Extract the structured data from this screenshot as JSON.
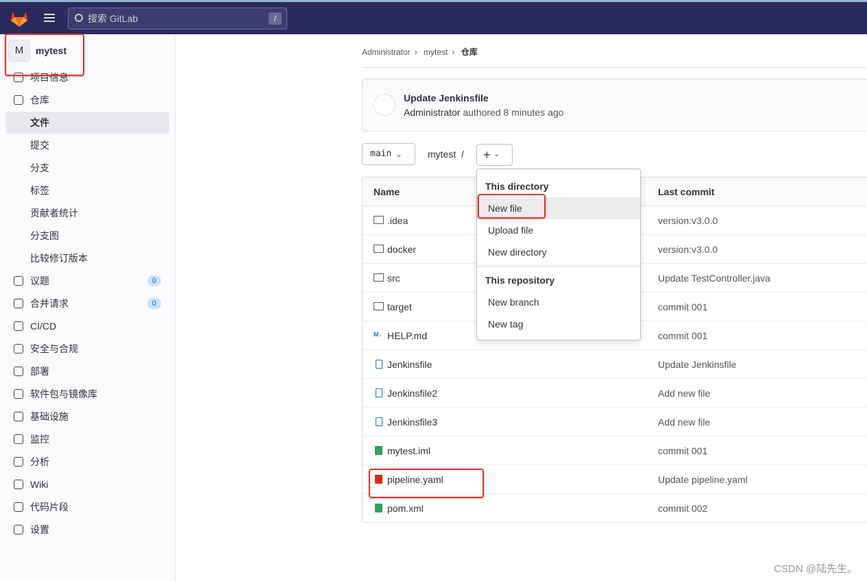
{
  "topbar": {
    "search_placeholder": "搜索 GitLab",
    "shortcut": "/"
  },
  "project": {
    "initial": "M",
    "name": "mytest"
  },
  "sidebar": {
    "items": [
      {
        "label": "项目信息",
        "icon": "project-info-icon"
      },
      {
        "label": "仓库",
        "icon": "repository-icon"
      },
      {
        "label": "文件",
        "active": true
      },
      {
        "label": "提交"
      },
      {
        "label": "分支"
      },
      {
        "label": "标签"
      },
      {
        "label": "贡献者统计"
      },
      {
        "label": "分支图"
      },
      {
        "label": "比较修订版本"
      },
      {
        "label": "议题",
        "icon": "issues-icon",
        "badge": "0"
      },
      {
        "label": "合并请求",
        "icon": "merge-request-icon",
        "badge": "0"
      },
      {
        "label": "CI/CD",
        "icon": "rocket-icon"
      },
      {
        "label": "安全与合规",
        "icon": "shield-icon"
      },
      {
        "label": "部署",
        "icon": "deploy-icon"
      },
      {
        "label": "软件包与镜像库",
        "icon": "package-icon"
      },
      {
        "label": "基础设施",
        "icon": "cloud-icon"
      },
      {
        "label": "监控",
        "icon": "monitor-icon"
      },
      {
        "label": "分析",
        "icon": "chart-icon"
      },
      {
        "label": "Wiki",
        "icon": "book-icon"
      },
      {
        "label": "代码片段",
        "icon": "scissors-icon"
      },
      {
        "label": "设置",
        "icon": "gear-icon"
      }
    ]
  },
  "breadcrumb": [
    "Administrator",
    "mytest",
    "仓库"
  ],
  "last_commit": {
    "title": "Update Jenkinsfile",
    "author": "Administrator",
    "meta": "authored 8 minutes ago"
  },
  "toolbar": {
    "branch": "main",
    "path": "mytest",
    "path_sep": "/"
  },
  "table": {
    "headers": [
      "Name",
      "Last commit"
    ],
    "rows": [
      {
        "name": ".idea",
        "type": "folder",
        "commit": "version:v3.0.0"
      },
      {
        "name": "docker",
        "type": "folder",
        "commit": "version:v3.0.0"
      },
      {
        "name": "src",
        "type": "folder",
        "commit": "Update TestController.java"
      },
      {
        "name": "target",
        "type": "folder",
        "commit": "commit 001"
      },
      {
        "name": "HELP.md",
        "type": "markdown",
        "commit": "commit 001"
      },
      {
        "name": "Jenkinsfile",
        "type": "file",
        "commit": "Update Jenkinsfile"
      },
      {
        "name": "Jenkinsfile2",
        "type": "file",
        "commit": "Add new file"
      },
      {
        "name": "Jenkinsfile3",
        "type": "file",
        "commit": "Add new file"
      },
      {
        "name": "mytest.iml",
        "type": "xml",
        "commit": "commit 001"
      },
      {
        "name": "pipeline.yaml",
        "type": "yaml",
        "commit": "Update pipeline.yaml"
      },
      {
        "name": "pom.xml",
        "type": "xml",
        "commit": "commit 002"
      }
    ]
  },
  "dropdown": {
    "section1": "This directory",
    "items1": [
      "New file",
      "Upload file",
      "New directory"
    ],
    "section2": "This repository",
    "items2": [
      "New branch",
      "New tag"
    ]
  },
  "watermark": "CSDN @陆先生。",
  "colors": {
    "topbar": "#2b2a5c",
    "highlight": "#e5332a"
  }
}
